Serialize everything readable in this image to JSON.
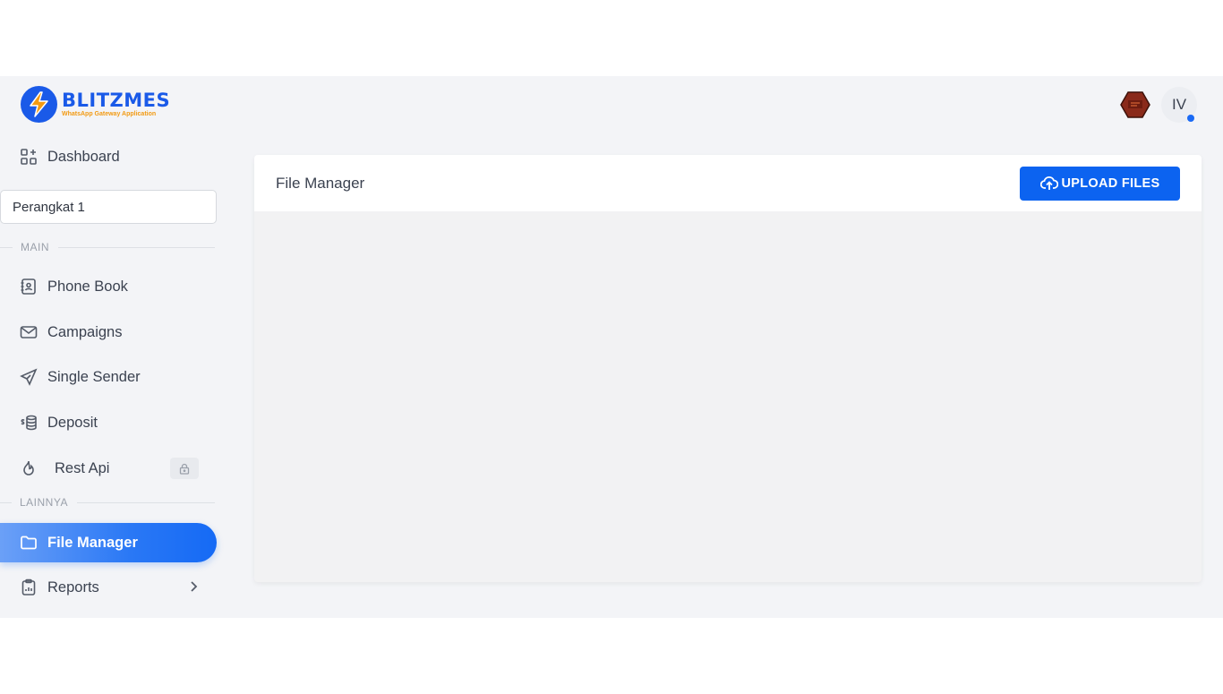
{
  "brand": {
    "name": "BLITZMES",
    "tagline": "WhatsApp Gateway Application"
  },
  "sidebar": {
    "dashboard": "Dashboard",
    "device_select": "Perangkat 1",
    "section_main": "MAIN",
    "items_main": [
      {
        "label": "Phone Book",
        "icon": "phonebook-icon"
      },
      {
        "label": "Campaigns",
        "icon": "mail-icon"
      },
      {
        "label": "Single Sender",
        "icon": "send-icon"
      },
      {
        "label": "Deposit",
        "icon": "coins-icon"
      },
      {
        "label": "Rest Api",
        "icon": "flame-icon",
        "locked": true
      }
    ],
    "section_other": "LAINNYA",
    "items_other": [
      {
        "label": "File Manager",
        "icon": "folder-icon",
        "active": true
      },
      {
        "label": "Reports",
        "icon": "clipboard-icon",
        "has_submenu": true
      }
    ]
  },
  "header": {
    "avatar_initials": "IV"
  },
  "main": {
    "card_title": "File Manager",
    "upload_button": "UPLOAD FILES"
  },
  "colors": {
    "accent": "#0c63f0",
    "brand": "#1a5ae8",
    "tagline": "#f29a13"
  }
}
